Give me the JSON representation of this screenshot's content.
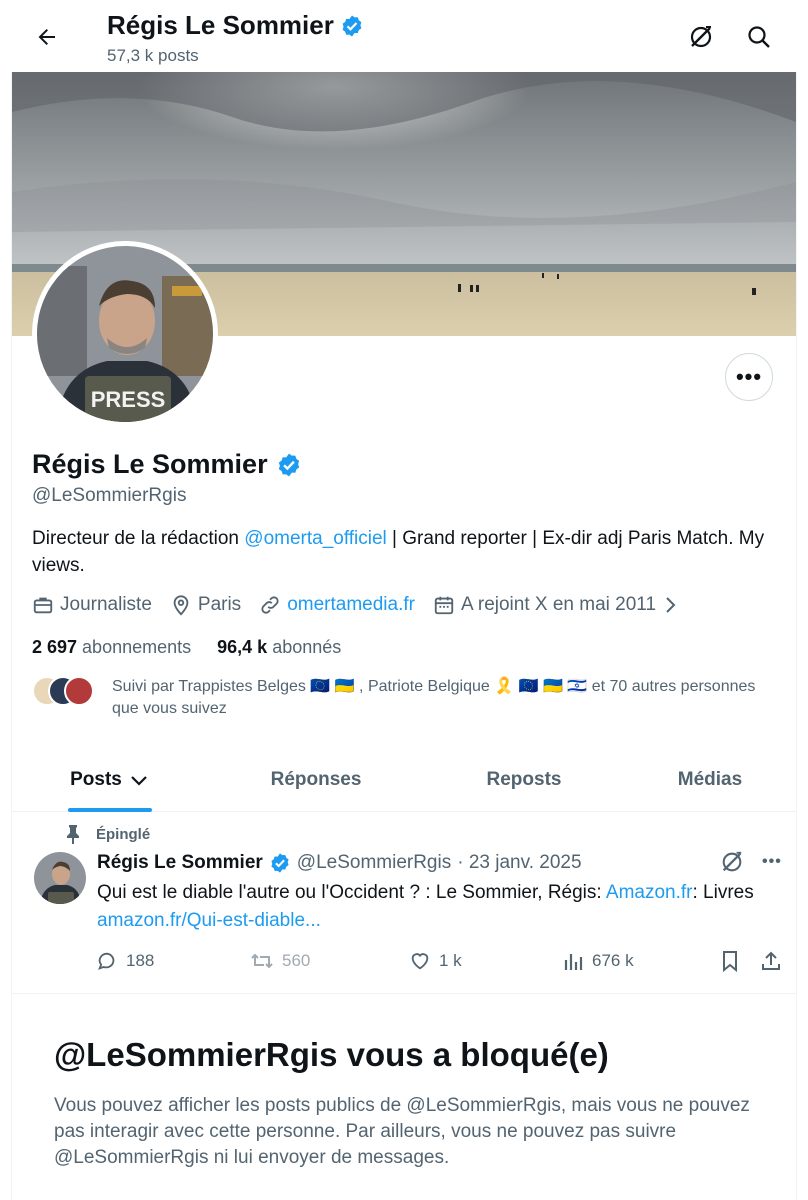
{
  "header": {
    "name": "Régis Le Sommier",
    "post_count": "57,3 k posts",
    "icons": [
      "back-arrow-icon",
      "grok-icon",
      "search-icon"
    ]
  },
  "profile": {
    "name": "Régis Le Sommier",
    "handle": "@LeSommierRgis",
    "verified": true,
    "avatar_badge_text": "PRESS",
    "bio_prefix": "Directeur de la rédaction ",
    "bio_mention": "@omerta_officiel",
    "bio_suffix": " | Grand reporter | Ex-dir adj Paris Match. My views.",
    "profession": "Journaliste",
    "location": "Paris",
    "website": "omertamedia.fr",
    "joined": "A rejoint X en mai 2011",
    "following_count": "2 697",
    "following_label": "abonnements",
    "followers_count": "96,4 k",
    "followers_label": "abonnés",
    "followed_by_part1": "Suivi par Trappistes Belges 🇪🇺 🇺🇦 , Patriote Belgique 🎗️ 🇪🇺 🇺🇦 🇮🇱 ",
    "followed_by_part2": "et 70 autres personnes que vous suivez"
  },
  "more_button": "•••",
  "tabs": [
    {
      "label": "Posts",
      "active": true
    },
    {
      "label": "Réponses",
      "active": false
    },
    {
      "label": "Reposts",
      "active": false
    },
    {
      "label": "Médias",
      "active": false
    }
  ],
  "pinned_post": {
    "pinned_label": "Épinglé",
    "author": "Régis Le Sommier",
    "handle": "@LeSommierRgis",
    "date": "· 23 janv. 2025",
    "text_part1": "Qui est le diable l'autre ou l'Occident ? : Le Sommier, Régis: ",
    "text_link1": "Amazon.fr",
    "text_part2": ": Livres ",
    "text_link2": "amazon.fr/Qui-est-diable...",
    "more": "•••",
    "replies": "188",
    "reposts": "560",
    "likes": "1 k",
    "views": "676 k"
  },
  "blocked": {
    "title": "@LeSommierRgis vous a bloqué(e)",
    "text": "Vous pouvez afficher les posts publics de @LeSommierRgis, mais vous ne pouvez pas interagir avec cette personne. Par ailleurs, vous ne pouvez pas suivre @LeSommierRgis ni lui envoyer de messages."
  },
  "colors": {
    "accent": "#1d9bf0",
    "secondary_text": "#536471",
    "primary_text": "#0f1419",
    "border": "#eff3f4"
  }
}
